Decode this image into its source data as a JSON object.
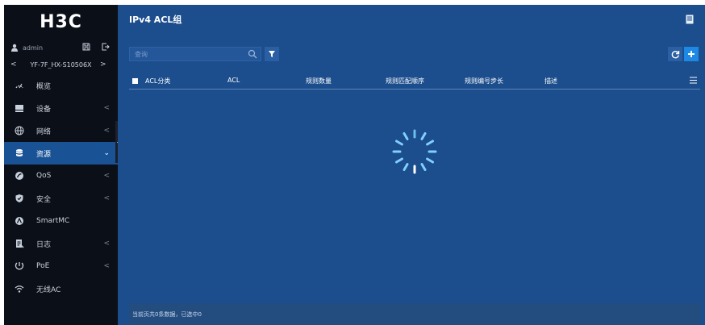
{
  "brand": {
    "logo_text": "H3C"
  },
  "user": {
    "name": "admin",
    "icon": "user-icon"
  },
  "device": {
    "name": "YF-7F_HX-S10506X",
    "prev": "<",
    "next": ">"
  },
  "menu": [
    {
      "label": "概览",
      "icon": "dashboard-gauge-icon",
      "chevron": ""
    },
    {
      "label": "设备",
      "icon": "device-icon",
      "chevron": "<"
    },
    {
      "label": "网络",
      "icon": "globe-icon",
      "chevron": "<"
    },
    {
      "label": "资源",
      "icon": "database-icon",
      "chevron": "⌄"
    },
    {
      "label": "QoS",
      "icon": "qos-icon",
      "chevron": "<"
    },
    {
      "label": "安全",
      "icon": "shield-icon",
      "chevron": "<"
    },
    {
      "label": "SmartMC",
      "icon": "smartmc-icon",
      "chevron": ""
    },
    {
      "label": "日志",
      "icon": "log-icon",
      "chevron": "<"
    },
    {
      "label": "PoE",
      "icon": "poe-icon",
      "chevron": "<"
    },
    {
      "label": "无线AC",
      "icon": "wifi-icon",
      "chevron": ""
    }
  ],
  "page": {
    "title": "IPv4 ACL组"
  },
  "search": {
    "placeholder": "查询",
    "value": ""
  },
  "table": {
    "columns": [
      "ACL分类",
      "ACL",
      "规则数量",
      "规则匹配顺序",
      "规则编号步长",
      "描述"
    ],
    "rows": []
  },
  "status": {
    "text": "当前页共0条数据，已选中0"
  },
  "colors": {
    "sidebar": "#0b0f17",
    "main": "#1c4d8c",
    "active": "#1a5296",
    "accent": "#1e88e5"
  }
}
